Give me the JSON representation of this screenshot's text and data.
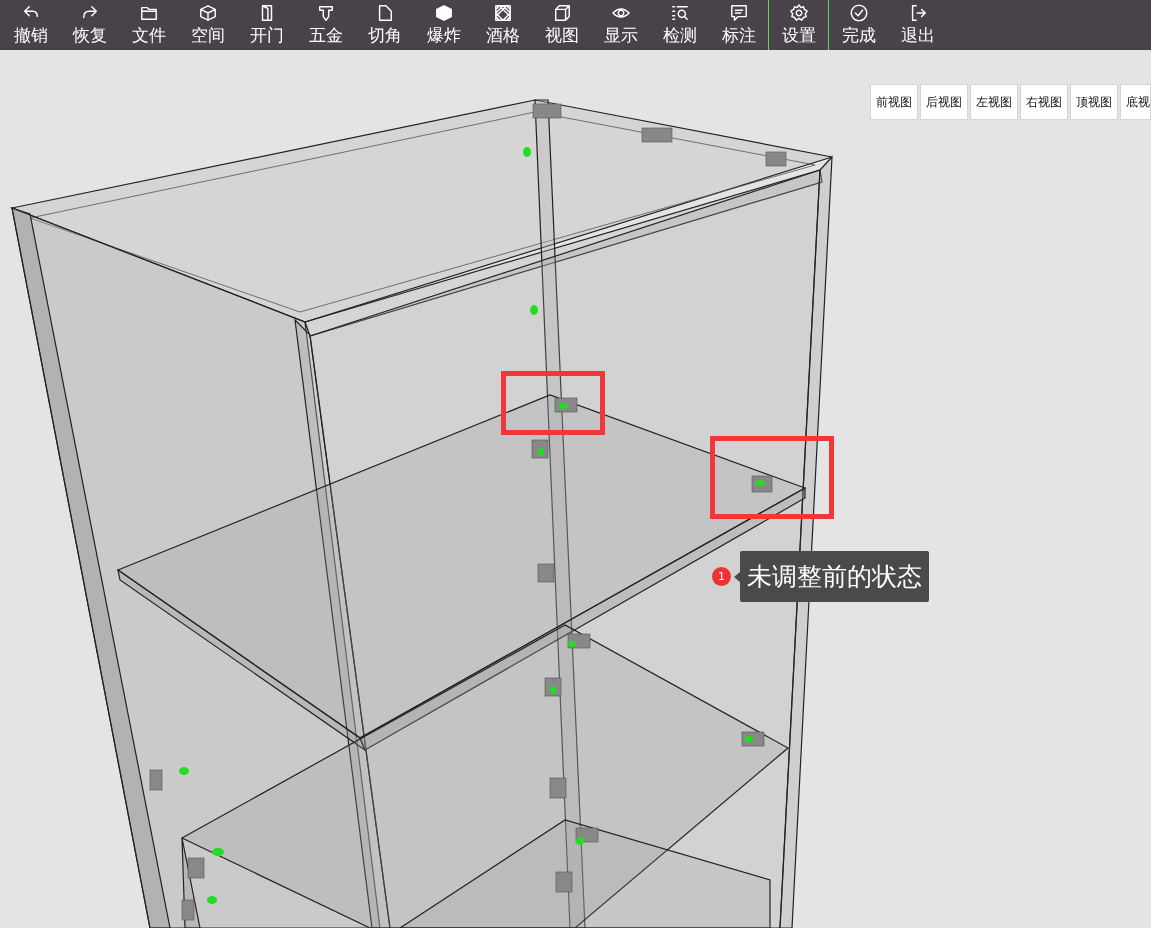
{
  "toolbar": [
    {
      "items": [
        {
          "label": "撤销"
        },
        {
          "label": "恢复"
        },
        {
          "label": "文件"
        },
        {
          "label": "空间"
        },
        {
          "label": "开门"
        },
        {
          "label": "五金"
        },
        {
          "label": "切角"
        },
        {
          "label": "爆炸"
        },
        {
          "label": "酒格"
        },
        {
          "label": "视图"
        },
        {
          "label": "显示"
        },
        {
          "label": "检测"
        },
        {
          "label": "标注"
        }
      ]
    },
    {
      "items": [
        {
          "label": "设置"
        }
      ]
    },
    {
      "items": [
        {
          "label": "完成"
        },
        {
          "label": "退出"
        }
      ]
    }
  ],
  "view_buttons": [
    "前视图",
    "后视图",
    "左视图",
    "右视图",
    "顶视图",
    "底视"
  ],
  "annotation": {
    "badge": "1",
    "text": "未调整前的状态"
  }
}
